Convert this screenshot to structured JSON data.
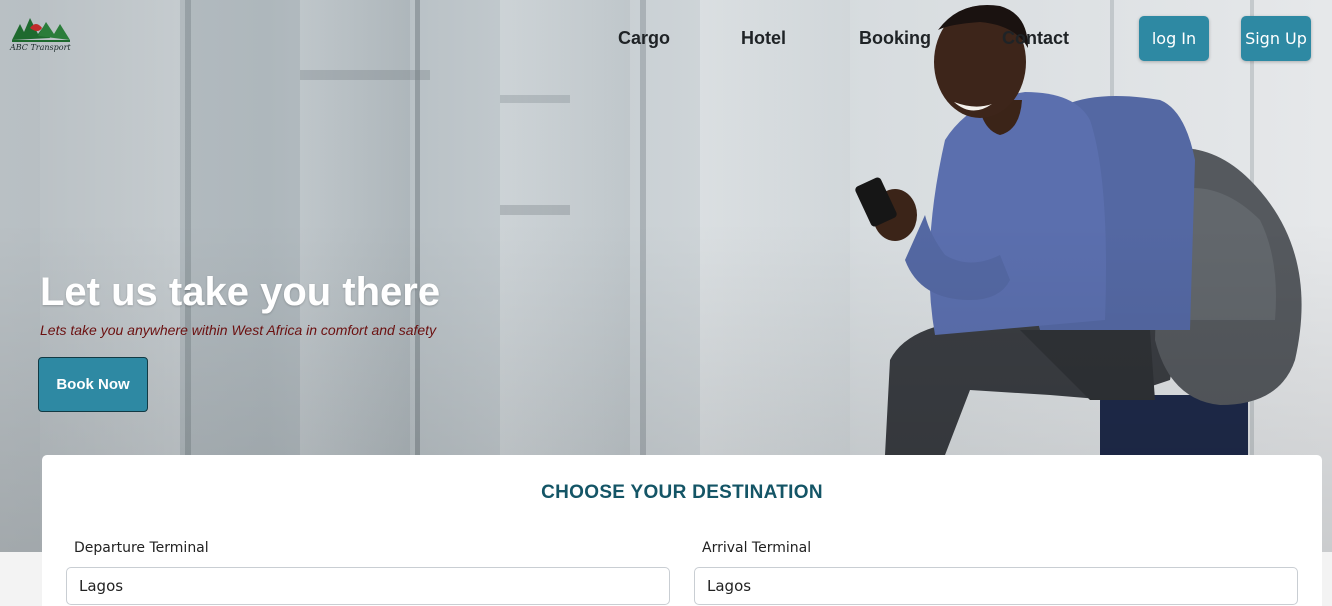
{
  "brand": {
    "logo_text": "ABC Transport"
  },
  "nav": {
    "links": [
      "Cargo",
      "Hotel",
      "Booking",
      "Contact"
    ],
    "login_label": "log In",
    "signup_label": "Sign Up"
  },
  "hero": {
    "title": "Let us take you there",
    "subtitle": "Lets take you anywhere within West Africa in comfort and safety",
    "cta_label": "Book Now"
  },
  "destination": {
    "heading": "CHOOSE YOUR DESTINATION",
    "departure_label": "Departure Terminal",
    "departure_value": "Lagos",
    "arrival_label": "Arrival Terminal",
    "arrival_value": "Lagos"
  },
  "colors": {
    "accent": "#2e89a3",
    "heading": "#145566",
    "subtitle": "#6b1010"
  }
}
